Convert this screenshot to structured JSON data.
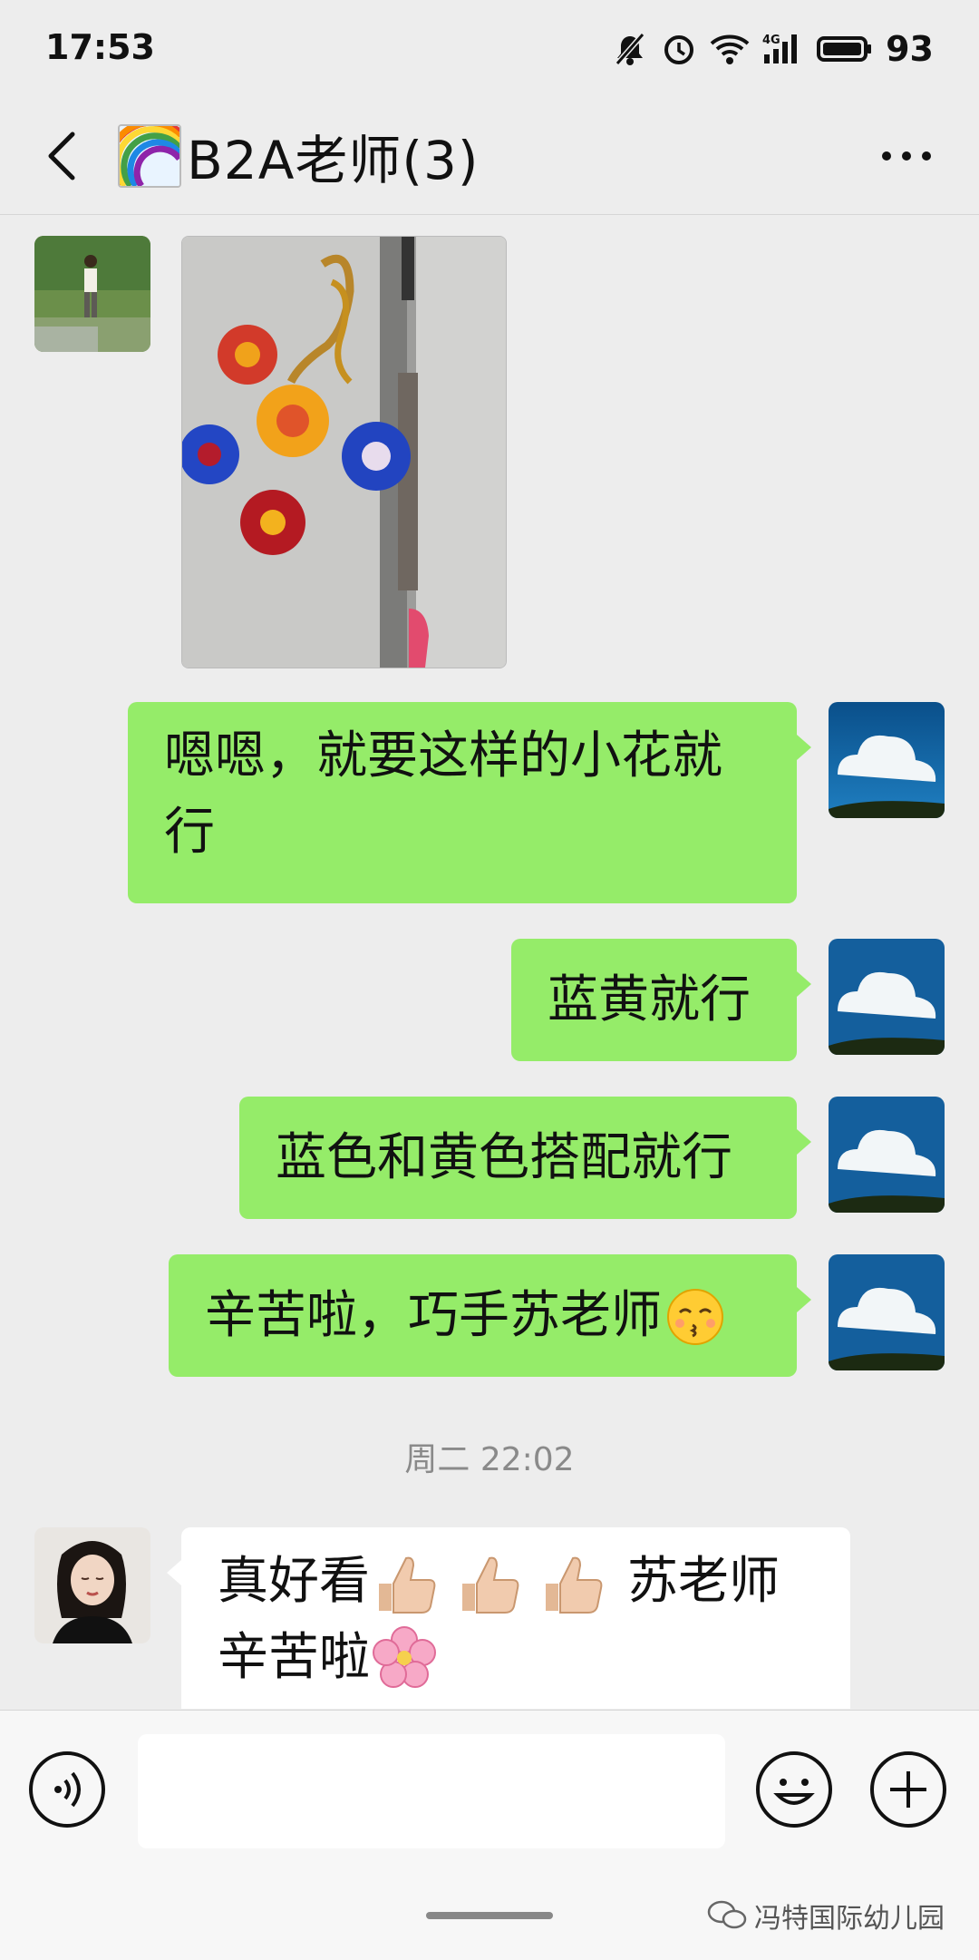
{
  "status_bar": {
    "time": "17:53",
    "network": "4G",
    "battery": "93",
    "icons": [
      "mute-bell-icon",
      "alarm-icon",
      "wifi-icon",
      "signal-icon",
      "battery-icon"
    ]
  },
  "header": {
    "title": "B2A老师(3)",
    "title_emoji_icon": "rainbow-icon",
    "back_icon": "chevron-left-icon",
    "more_icon": "more-dots-icon"
  },
  "messages": [
    {
      "direction": "incoming",
      "type": "image",
      "sender_avatar": "avatar-person-garden",
      "image_desc_icon": "crochet-flowers-photo"
    },
    {
      "direction": "outgoing",
      "type": "text",
      "line1": "嗯嗯，就要这样的小花就",
      "line2": "行"
    },
    {
      "direction": "outgoing",
      "type": "text",
      "text": "蓝黄就行"
    },
    {
      "direction": "outgoing",
      "type": "text",
      "text": "蓝色和黄色搭配就行"
    },
    {
      "direction": "outgoing",
      "type": "text",
      "text": "辛苦啦，巧手苏老师",
      "trailing_emoji": "kissing-face-icon"
    },
    {
      "direction": "incoming",
      "type": "text",
      "line1_a": "真好看",
      "line1_b": "苏老师",
      "line2": "辛苦啦",
      "emoji_icons": [
        "thumbs-up-icon",
        "thumbs-up-icon",
        "thumbs-up-icon",
        "cherry-blossom-icon"
      ]
    }
  ],
  "timestamp": "周二 22:02",
  "input_bar": {
    "placeholder": "",
    "voice_icon": "voice-icon",
    "emoji_icon": "smile-icon",
    "plus_icon": "plus-icon"
  },
  "watermark": "冯特国际幼儿园",
  "colors": {
    "background": "#ededed",
    "outgoing_bubble": "#95ec69",
    "incoming_bubble": "#ffffff",
    "timestamp": "#8a8a8a"
  }
}
